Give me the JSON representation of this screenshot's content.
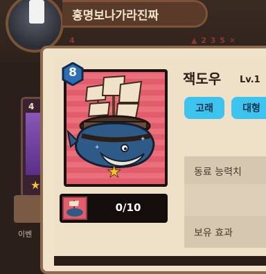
{
  "background": {
    "player_name": "홍명보나가라진짜",
    "status_left": "4",
    "status_right": "▲ 2 3 5 ✕",
    "side_card_level": "4",
    "side_caption": "이벤"
  },
  "unit": {
    "level_badge": "8",
    "name": "잭도우",
    "level_label": "Lv.1",
    "tags": [
      "고래",
      "대형"
    ],
    "progress": "0/10",
    "progress_fraction": 0
  },
  "sections": {
    "ability": "동료 능력치",
    "effect": "보유 효과"
  },
  "colors": {
    "accent_blue": "#3cc3ee",
    "card_red": "#e25c6b",
    "badge_blue": "#2d6fb5"
  }
}
